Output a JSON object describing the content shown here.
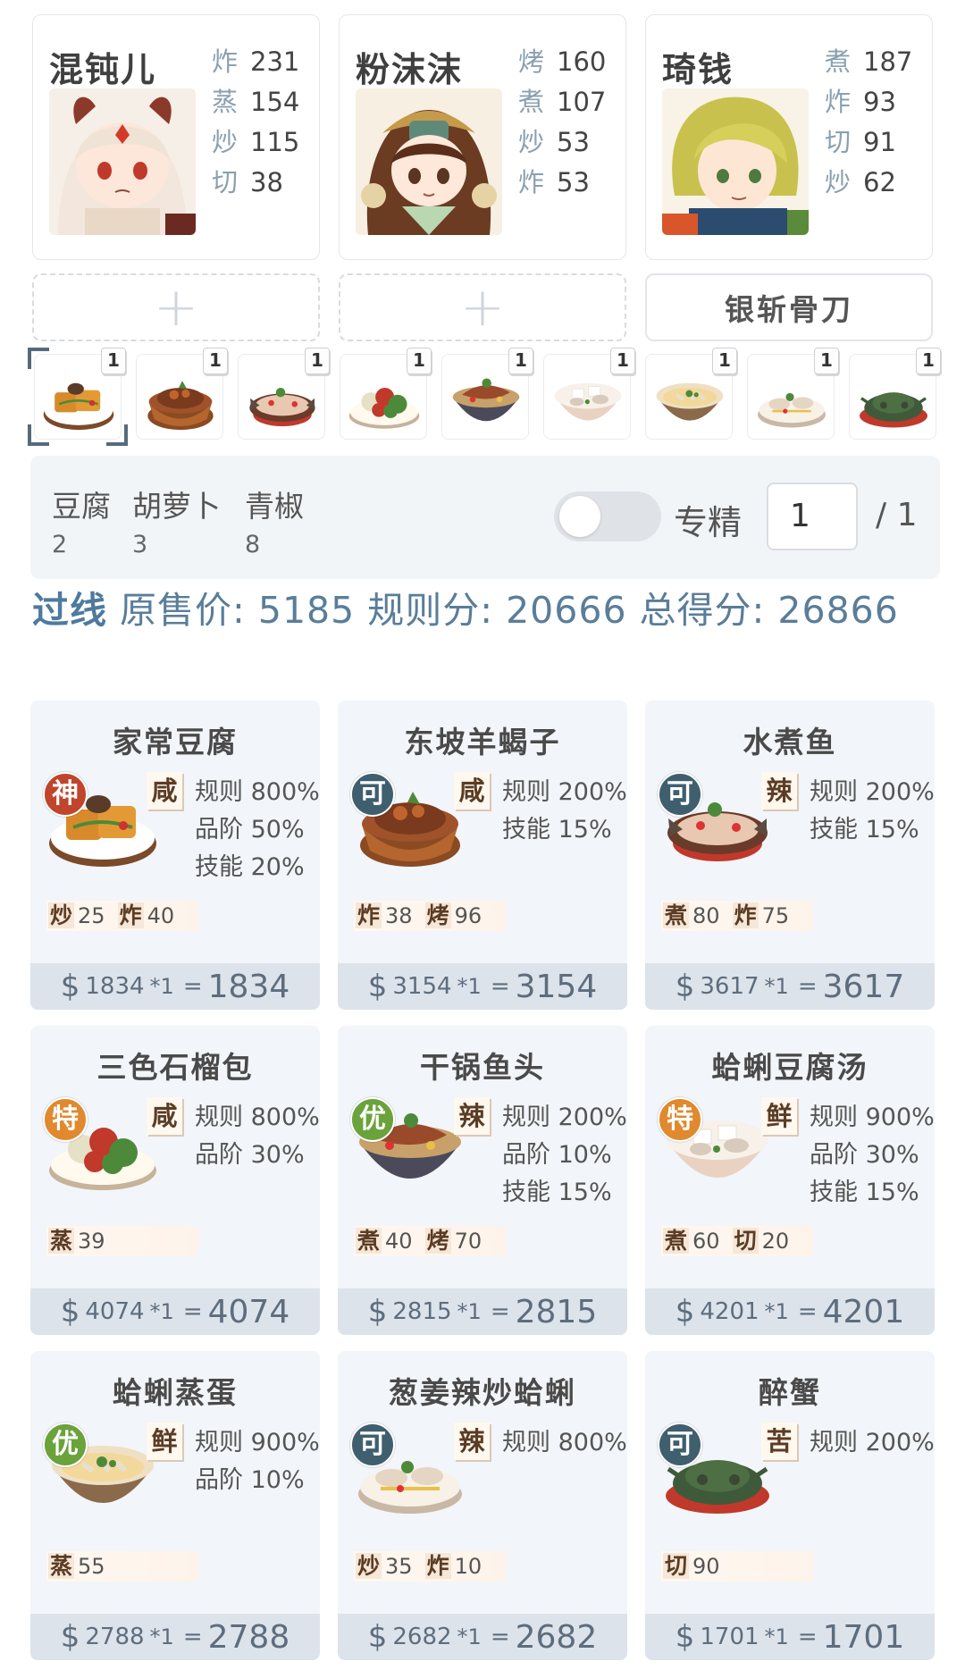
{
  "chefs": [
    {
      "name": "混钝儿",
      "skills": [
        {
          "name": "炸",
          "value": "231"
        },
        {
          "name": "蒸",
          "value": "154"
        },
        {
          "name": "炒",
          "value": "115"
        },
        {
          "name": "切",
          "value": "38"
        }
      ]
    },
    {
      "name": "粉沫沫",
      "skills": [
        {
          "name": "烤",
          "value": "160"
        },
        {
          "name": "煮",
          "value": "107"
        },
        {
          "name": "炒",
          "value": "53"
        },
        {
          "name": "炸",
          "value": "53"
        }
      ]
    },
    {
      "name": "琦钱",
      "skills": [
        {
          "name": "煮",
          "value": "187"
        },
        {
          "name": "炸",
          "value": "93"
        },
        {
          "name": "切",
          "value": "91"
        },
        {
          "name": "炒",
          "value": "62"
        }
      ]
    }
  ],
  "slots": {
    "add_symbol": "+",
    "equipment": "银斩骨刀"
  },
  "thumb_badge": "1",
  "ingredients": [
    {
      "name": "豆腐",
      "count": "2"
    },
    {
      "name": "胡萝卜",
      "count": "3"
    },
    {
      "name": "青椒",
      "count": "8"
    }
  ],
  "controls": {
    "toggle_label": "专精",
    "quantity": "1",
    "quantity_total": "/ 1"
  },
  "summary": {
    "pass": "过线",
    "text": " 原售价: 5185 规则分: 20666 总得分: 26866"
  },
  "colors": {
    "grade_神": "#c0452c",
    "grade_特": "#e0892e",
    "grade_优": "#6aa23c",
    "grade_可": "#3f5f6f"
  },
  "dishes": [
    {
      "name": "家常豆腐",
      "grade": "神",
      "flavor": "咸",
      "bonuses": [
        "规则 800%",
        "品阶 50%",
        "技能 20%"
      ],
      "reqs": [
        {
          "s": "炒",
          "v": "25"
        },
        {
          "s": "炸",
          "v": "40"
        }
      ],
      "currency": "$",
      "base": "1834",
      "mult": "*1",
      "eq": "=",
      "total": "1834"
    },
    {
      "name": "东坡羊蝎子",
      "grade": "可",
      "flavor": "咸",
      "bonuses": [
        "规则 200%",
        "技能 15%"
      ],
      "reqs": [
        {
          "s": "炸",
          "v": "38"
        },
        {
          "s": "烤",
          "v": "96"
        }
      ],
      "currency": "$",
      "base": "3154",
      "mult": "*1",
      "eq": "=",
      "total": "3154"
    },
    {
      "name": "水煮鱼",
      "grade": "可",
      "flavor": "辣",
      "bonuses": [
        "规则 200%",
        "技能 15%"
      ],
      "reqs": [
        {
          "s": "煮",
          "v": "80"
        },
        {
          "s": "炸",
          "v": "75"
        }
      ],
      "currency": "$",
      "base": "3617",
      "mult": "*1",
      "eq": "=",
      "total": "3617"
    },
    {
      "name": "三色石榴包",
      "grade": "特",
      "flavor": "咸",
      "bonuses": [
        "规则 800%",
        "品阶 30%"
      ],
      "reqs": [
        {
          "s": "蒸",
          "v": "39"
        }
      ],
      "currency": "$",
      "base": "4074",
      "mult": "*1",
      "eq": "=",
      "total": "4074"
    },
    {
      "name": "干锅鱼头",
      "grade": "优",
      "flavor": "辣",
      "bonuses": [
        "规则 200%",
        "品阶 10%",
        "技能 15%"
      ],
      "reqs": [
        {
          "s": "煮",
          "v": "40"
        },
        {
          "s": "烤",
          "v": "70"
        }
      ],
      "currency": "$",
      "base": "2815",
      "mult": "*1",
      "eq": "=",
      "total": "2815"
    },
    {
      "name": "蛤蜊豆腐汤",
      "grade": "特",
      "flavor": "鲜",
      "bonuses": [
        "规则 900%",
        "品阶 30%",
        "技能 15%"
      ],
      "reqs": [
        {
          "s": "煮",
          "v": "60"
        },
        {
          "s": "切",
          "v": "20"
        }
      ],
      "currency": "$",
      "base": "4201",
      "mult": "*1",
      "eq": "=",
      "total": "4201"
    },
    {
      "name": "蛤蜊蒸蛋",
      "grade": "优",
      "flavor": "鲜",
      "bonuses": [
        "规则 900%",
        "品阶 10%"
      ],
      "reqs": [
        {
          "s": "蒸",
          "v": "55"
        }
      ],
      "currency": "$",
      "base": "2788",
      "mult": "*1",
      "eq": "=",
      "total": "2788"
    },
    {
      "name": "葱姜辣炒蛤蜊",
      "grade": "可",
      "flavor": "辣",
      "bonuses": [
        "规则 800%"
      ],
      "reqs": [
        {
          "s": "炒",
          "v": "35"
        },
        {
          "s": "炸",
          "v": "10"
        }
      ],
      "currency": "$",
      "base": "2682",
      "mult": "*1",
      "eq": "=",
      "total": "2682"
    },
    {
      "name": "醉蟹",
      "grade": "可",
      "flavor": "苦",
      "bonuses": [
        "规则 200%"
      ],
      "reqs": [
        {
          "s": "切",
          "v": "90"
        }
      ],
      "currency": "$",
      "base": "1701",
      "mult": "*1",
      "eq": "=",
      "total": "1701"
    }
  ]
}
